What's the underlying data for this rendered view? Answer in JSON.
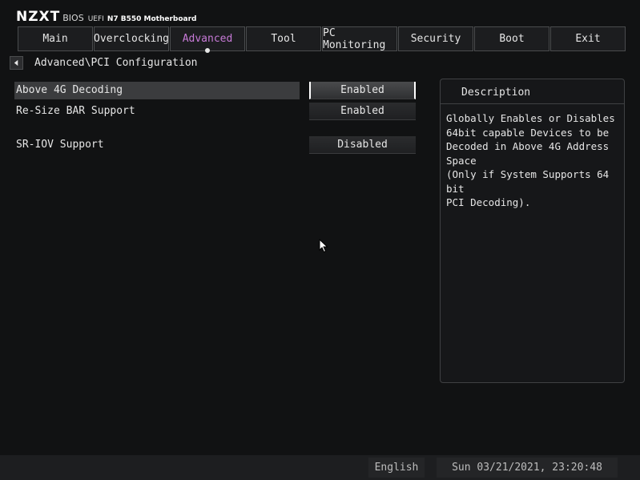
{
  "brand": {
    "logo": "NZXT",
    "bios": "BIOS",
    "uefi": "UEFI",
    "model": "N7 B550 Motherboard"
  },
  "tabs": [
    {
      "label": "Main"
    },
    {
      "label": "Overclocking"
    },
    {
      "label": "Advanced",
      "active": true
    },
    {
      "label": "Tool"
    },
    {
      "label": "PC Monitoring"
    },
    {
      "label": "Security"
    },
    {
      "label": "Boot"
    },
    {
      "label": "Exit"
    }
  ],
  "breadcrumb": "Advanced\\PCI Configuration",
  "settings": [
    {
      "label": "Above 4G Decoding",
      "value": "Enabled",
      "selected": true
    },
    {
      "label": "Re-Size BAR Support",
      "value": "Enabled"
    },
    {
      "label": "SR-IOV Support",
      "value": "Disabled"
    }
  ],
  "description": {
    "title": "Description",
    "text": "Globally Enables or Disables\n64bit capable Devices to be\nDecoded in Above 4G Address Space\n(Only if System Supports 64 bit\nPCI Decoding)."
  },
  "status": {
    "language": "English",
    "datetime": "Sun 03/21/2021, 23:20:48"
  },
  "colors": {
    "active_tab": "#c77ad7",
    "background": "#111213"
  },
  "icons": [
    "back-arrow-icon",
    "mouse-cursor-icon"
  ]
}
